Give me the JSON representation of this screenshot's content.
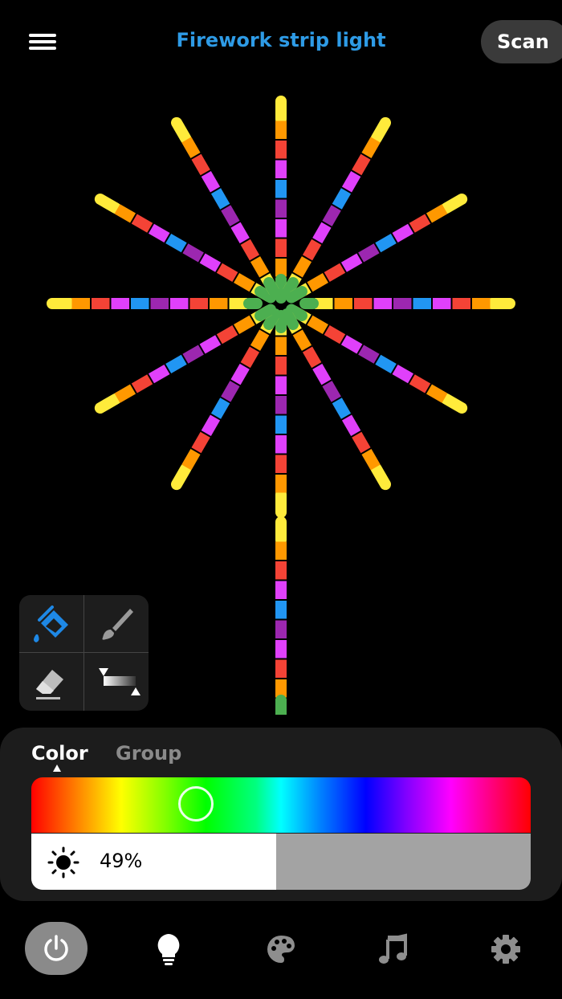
{
  "header": {
    "title": "Firework strip light",
    "scan_label": "Scan"
  },
  "colors": {
    "accent": "#2E9BE6",
    "segment_palette": [
      "#FFEB3B",
      "#FF9800",
      "#F44336",
      "#E040FB",
      "#2196F3",
      "#9C27B0",
      "#4CAF50"
    ]
  },
  "tools": [
    {
      "name": "fill-bucket-icon",
      "active": true
    },
    {
      "name": "brush-icon",
      "active": false
    },
    {
      "name": "eraser-icon",
      "active": false
    },
    {
      "name": "gradient-icon",
      "active": false
    }
  ],
  "panel": {
    "tabs": [
      {
        "label": "Color",
        "active": true
      },
      {
        "label": "Group",
        "active": false
      }
    ],
    "hue_position": 0.33,
    "brightness_value": 0.49,
    "brightness_label": "49%"
  },
  "nav": [
    {
      "icon": "power-icon",
      "active": true
    },
    {
      "icon": "bulb-icon",
      "active": false
    },
    {
      "icon": "palette-icon",
      "active": false
    },
    {
      "icon": "music-note-icon",
      "active": false
    },
    {
      "icon": "gear-icon",
      "active": false
    }
  ]
}
